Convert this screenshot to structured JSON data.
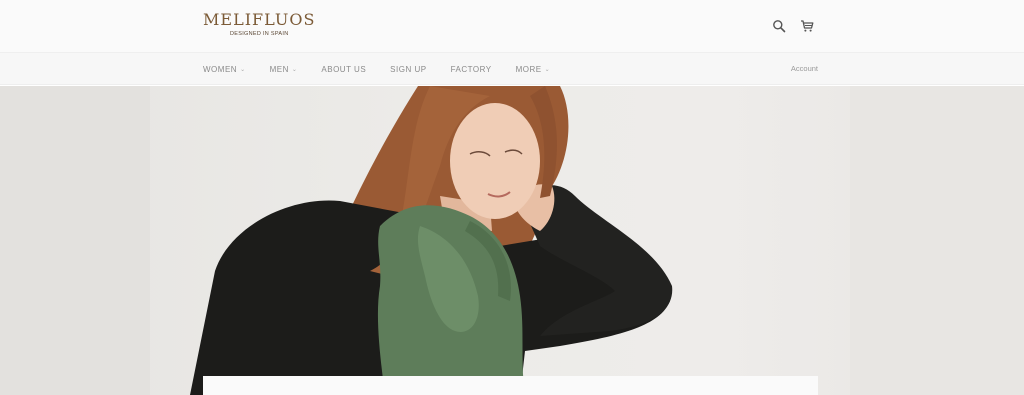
{
  "brand": {
    "name": "MELIFLUOS",
    "tagline": "DESIGNED IN SPAIN"
  },
  "header": {
    "icons": [
      "search-icon",
      "cart-icon"
    ]
  },
  "nav": {
    "items": [
      {
        "label": "WOMEN",
        "has_dropdown": true
      },
      {
        "label": "MEN",
        "has_dropdown": true
      },
      {
        "label": "ABOUT US",
        "has_dropdown": false
      },
      {
        "label": "SIGN UP",
        "has_dropdown": false
      },
      {
        "label": "FACTORY",
        "has_dropdown": false
      },
      {
        "label": "MORE",
        "has_dropdown": true
      }
    ],
    "account_label": "Account",
    "caret": "⌄"
  },
  "colors": {
    "brand": "#7b5a36",
    "scarf": "#5e7d5a",
    "sweater": "#1c1c1a",
    "hair": "#9a5a34"
  }
}
